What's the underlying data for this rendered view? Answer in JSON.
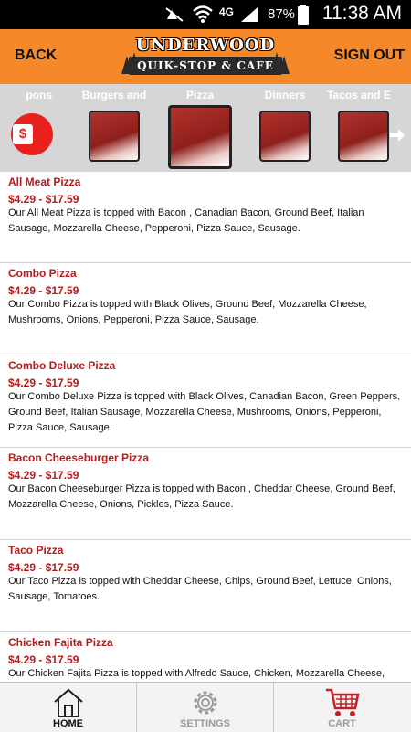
{
  "status_bar": {
    "network": "4G",
    "battery": "87%",
    "time": "11:38 AM"
  },
  "header": {
    "back_label": "BACK",
    "sign_out_label": "SIGN OUT",
    "logo_line1": "UNDERWOOD",
    "logo_line2": "QUIK-STOP & CAFE"
  },
  "categories": [
    {
      "label": "Coupons",
      "shown": "pons",
      "type": "coupon"
    },
    {
      "label": "Burgers and",
      "shown": "Burgers and",
      "type": "thumb"
    },
    {
      "label": "Pizza",
      "shown": "Pizza",
      "type": "thumb",
      "selected": true
    },
    {
      "label": "Dinners",
      "shown": "Dinners",
      "type": "thumb"
    },
    {
      "label": "Tacos and E",
      "shown": "Tacos and E",
      "type": "thumb"
    }
  ],
  "menu_items": [
    {
      "name": "All Meat Pizza",
      "price": "$4.29 - $17.59",
      "description": "Our All Meat Pizza is topped with Bacon , Canadian Bacon, Ground Beef, Italian Sausage, Mozzarella Cheese, Pepperoni, Pizza Sauce, Sausage."
    },
    {
      "name": "Combo Pizza",
      "price": "$4.29 - $17.59",
      "description": "Our Combo Pizza is topped with Black Olives, Ground Beef, Mozzarella Cheese, Mushrooms, Onions, Pepperoni, Pizza Sauce, Sausage."
    },
    {
      "name": "Combo Deluxe Pizza",
      "price": "$4.29 - $17.59",
      "description": "Our Combo Deluxe Pizza is topped with Black Olives, Canadian Bacon, Green Peppers, Ground Beef, Italian Sausage, Mozzarella Cheese, Mushrooms, Onions, Pepperoni, Pizza Sauce, Sausage."
    },
    {
      "name": "Bacon Cheeseburger Pizza",
      "price": "$4.29 - $17.59",
      "description": "Our Bacon Cheeseburger Pizza is topped with Bacon , Cheddar Cheese, Ground Beef, Mozzarella Cheese, Onions, Pickles, Pizza Sauce."
    },
    {
      "name": "Taco Pizza",
      "price": "$4.29 - $17.59",
      "description": "Our Taco Pizza is topped with Cheddar Cheese, Chips, Ground Beef, Lettuce, Onions, Sausage, Tomatoes."
    },
    {
      "name": "Chicken Fajita Pizza",
      "price": "$4.29 - $17.59",
      "description": "Our Chicken Fajita Pizza is topped with Alfredo Sauce, Chicken, Mozzarella Cheese,"
    }
  ],
  "tabs": [
    {
      "label": "HOME",
      "icon": "home-icon",
      "active": true
    },
    {
      "label": "SETTINGS",
      "icon": "gear-icon",
      "active": false
    },
    {
      "label": "CART",
      "icon": "cart-icon",
      "active": false
    }
  ],
  "colors": {
    "header": "#f5892a",
    "accent_red": "#b51c1c",
    "category_bar": "#d6d6d6"
  }
}
